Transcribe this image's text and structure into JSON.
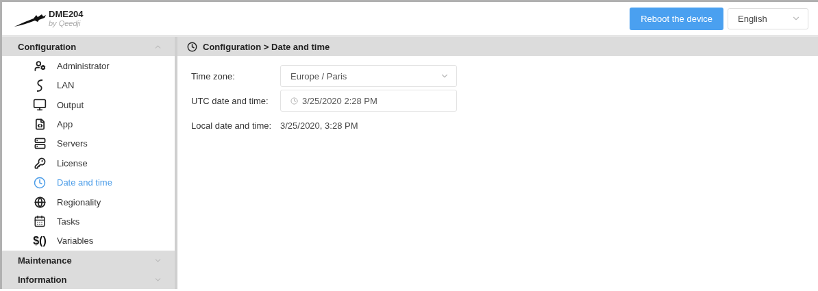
{
  "brand": {
    "name": "DME204",
    "byline": "by Qeedji"
  },
  "header": {
    "reboot_button": "Reboot the device",
    "language": {
      "value": "English"
    }
  },
  "sidebar": {
    "sections": [
      {
        "title": "Configuration",
        "expanded": true,
        "items": [
          {
            "label": "Administrator",
            "selected": false
          },
          {
            "label": "LAN",
            "selected": false
          },
          {
            "label": "Output",
            "selected": false
          },
          {
            "label": "App",
            "selected": false
          },
          {
            "label": "Servers",
            "selected": false
          },
          {
            "label": "License",
            "selected": false
          },
          {
            "label": "Date and time",
            "selected": true
          },
          {
            "label": "Regionality",
            "selected": false
          },
          {
            "label": "Tasks",
            "selected": false
          },
          {
            "label": "Variables",
            "selected": false,
            "glyph": "$()"
          }
        ]
      },
      {
        "title": "Maintenance",
        "expanded": false
      },
      {
        "title": "Information",
        "expanded": false
      }
    ]
  },
  "content": {
    "breadcrumb": "Configuration > Date and time",
    "fields": [
      {
        "kind": "select",
        "label": "Time zone:",
        "value": "Europe / Paris"
      },
      {
        "kind": "datetime",
        "label": "UTC date and time:",
        "value": "3/25/2020 2:28 PM"
      },
      {
        "kind": "text",
        "label": "Local date and time:",
        "value": "3/25/2020, 3:28 PM"
      }
    ]
  }
}
